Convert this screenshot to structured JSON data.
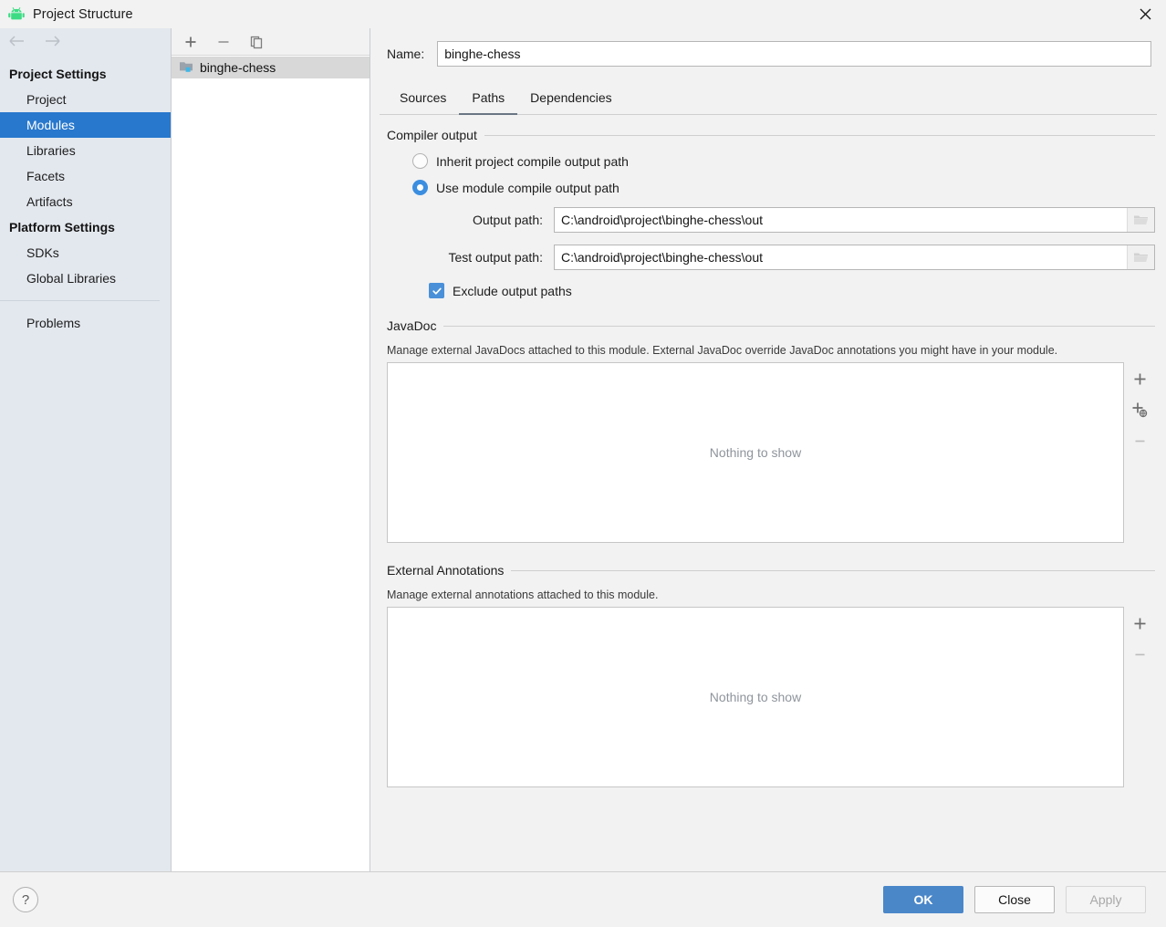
{
  "window": {
    "title": "Project Structure",
    "app_icon": "android-icon",
    "close_icon": "close-icon"
  },
  "nav": {
    "back_icon": "arrow-left-icon",
    "forward_icon": "arrow-right-icon"
  },
  "sidebar": {
    "groups": [
      {
        "label": "Project Settings",
        "items": [
          {
            "label": "Project",
            "selected": false
          },
          {
            "label": "Modules",
            "selected": true
          },
          {
            "label": "Libraries",
            "selected": false
          },
          {
            "label": "Facets",
            "selected": false
          },
          {
            "label": "Artifacts",
            "selected": false
          }
        ]
      },
      {
        "label": "Platform Settings",
        "items": [
          {
            "label": "SDKs",
            "selected": false
          },
          {
            "label": "Global Libraries",
            "selected": false
          }
        ]
      }
    ],
    "extra_items": [
      {
        "label": "Problems",
        "selected": false
      }
    ],
    "selected_color": "#2878cd",
    "background": "#e3e8ee"
  },
  "modules": {
    "toolbar": [
      {
        "name": "add-module-button",
        "icon": "plus-icon"
      },
      {
        "name": "remove-module-button",
        "icon": "minus-icon"
      },
      {
        "name": "copy-module-button",
        "icon": "copy-icon"
      }
    ],
    "tree": [
      {
        "label": "binghe-chess",
        "icon": "module-folder-icon",
        "selected": true
      }
    ]
  },
  "name_field": {
    "label": "Name:",
    "value": "binghe-chess",
    "placeholder": ""
  },
  "tabs": [
    {
      "label": "Sources",
      "active": false
    },
    {
      "label": "Paths",
      "active": true
    },
    {
      "label": "Dependencies",
      "active": false
    }
  ],
  "compiler_output": {
    "title": "Compiler output",
    "options": [
      {
        "label": "Inherit project compile output path",
        "checked": false
      },
      {
        "label": "Use module compile output path",
        "checked": true
      }
    ],
    "output_path": {
      "label": "Output path:",
      "value": "C:\\android\\project\\binghe-chess\\out",
      "browse_icon": "folder-icon"
    },
    "test_output_path": {
      "label": "Test output path:",
      "value": "C:\\android\\project\\binghe-chess\\out",
      "browse_icon": "folder-icon"
    },
    "exclude_checkbox": {
      "label": "Exclude output paths",
      "checked": true,
      "icon": "check-icon"
    }
  },
  "javadoc": {
    "title": "JavaDoc",
    "description": "Manage external JavaDocs attached to this module. External JavaDoc override JavaDoc annotations you might have in your module.",
    "empty_text": "Nothing to show",
    "tools": [
      {
        "name": "add-javadoc-button",
        "icon": "plus-icon",
        "disabled": false
      },
      {
        "name": "add-javadoc-url-button",
        "icon": "plus-globe-icon",
        "disabled": false
      },
      {
        "name": "remove-javadoc-button",
        "icon": "minus-icon",
        "disabled": true
      }
    ]
  },
  "external_annotations": {
    "title": "External Annotations",
    "description": "Manage external annotations attached to this module.",
    "empty_text": "Nothing to show",
    "tools": [
      {
        "name": "add-annotation-button",
        "icon": "plus-icon",
        "disabled": false
      },
      {
        "name": "remove-annotation-button",
        "icon": "minus-icon",
        "disabled": true
      }
    ]
  },
  "footer": {
    "help_label": "?",
    "ok_label": "OK",
    "close_label": "Close",
    "apply_label": "Apply",
    "apply_disabled": true,
    "primary_color": "#4a87c9"
  }
}
